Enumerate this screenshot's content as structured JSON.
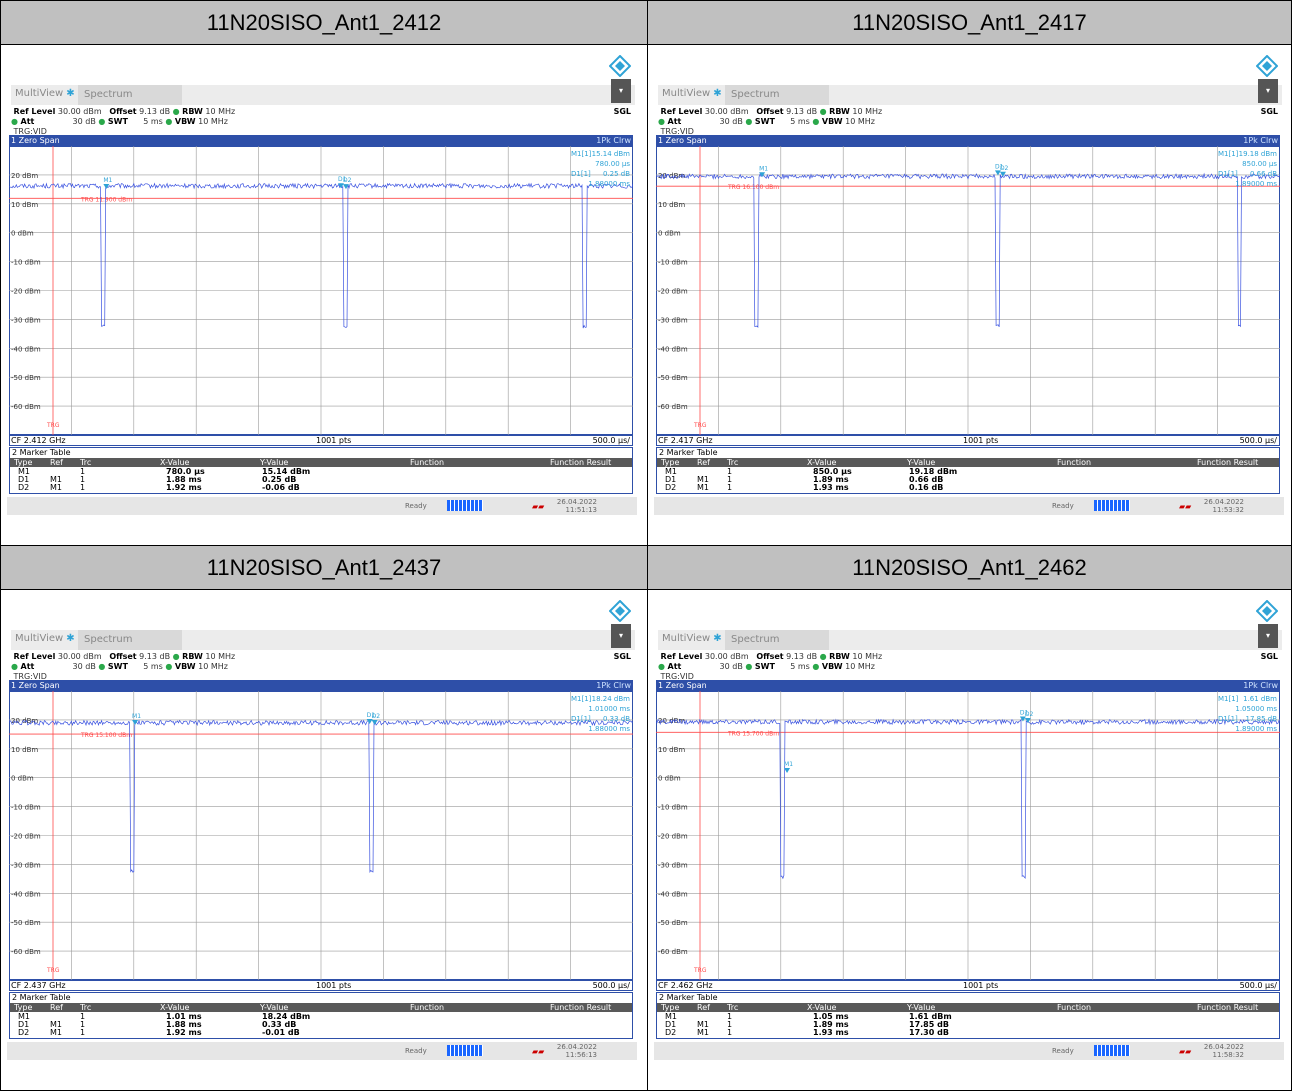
{
  "panels": [
    {
      "title": "11N20SISO_Ant1_2412",
      "ui": {
        "tab1": "MultiView",
        "tab2": "Spectrum",
        "mode": "SGL",
        "ref_level_label": "Ref Level",
        "ref_level": "30.00 dBm",
        "offset_label": "Offset",
        "offset": "9.13 dB",
        "rbw_label": "RBW",
        "rbw": "10 MHz",
        "att_label": "Att",
        "att": "30 dB",
        "swt_label": "SWT",
        "swt": "5 ms",
        "vbw_label": "VBW",
        "vbw": "10 MHz",
        "trg": "TRG:VID",
        "window": "1 Zero Span",
        "trace": "1Pk Clrw",
        "cf": "CF 2.412 GHz",
        "pts": "1001 pts",
        "div": "500.0 µs/",
        "trg_level": "TRG 11.900 dBm",
        "m1_label": "M1[1]",
        "m1_val": "15.14 dBm",
        "m1_time": "780.00 µs",
        "d1_label": "D1[1]",
        "d1_val": "0.25 dB",
        "d1_time": "1.88000 ms",
        "status": "Ready",
        "date": "26.04.2022",
        "time": "11:51:13"
      },
      "marker_table": {
        "title": "2 Marker Table",
        "headers": [
          "Type",
          "Ref",
          "Trc",
          "X-Value",
          "Y-Value",
          "Function",
          "Function Result"
        ],
        "rows": [
          [
            "M1",
            "",
            "1",
            "780.0 µs",
            "15.14 dBm"
          ],
          [
            "D1",
            "M1",
            "1",
            "1.88 ms",
            "0.25 dB"
          ],
          [
            "D2",
            "M1",
            "1",
            "1.92 ms",
            "-0.06 dB"
          ]
        ]
      }
    },
    {
      "title": "11N20SISO_Ant1_2417",
      "ui": {
        "tab1": "MultiView",
        "tab2": "Spectrum",
        "mode": "SGL",
        "ref_level_label": "Ref Level",
        "ref_level": "30.00 dBm",
        "offset_label": "Offset",
        "offset": "9.13 dB",
        "rbw_label": "RBW",
        "rbw": "10 MHz",
        "att_label": "Att",
        "att": "30 dB",
        "swt_label": "SWT",
        "swt": "5 ms",
        "vbw_label": "VBW",
        "vbw": "10 MHz",
        "trg": "TRG:VID",
        "window": "1 Zero Span",
        "trace": "1Pk Clrw",
        "cf": "CF 2.417 GHz",
        "pts": "1001 pts",
        "div": "500.0 µs/",
        "trg_level": "TRG 16.100 dBm",
        "m1_label": "M1[1]",
        "m1_val": "19.18 dBm",
        "m1_time": "850.00 µs",
        "d1_label": "D1[1]",
        "d1_val": "0.66 dB",
        "d1_time": "1.89000 ms",
        "status": "Ready",
        "date": "26.04.2022",
        "time": "11:53:32"
      },
      "marker_table": {
        "title": "2 Marker Table",
        "headers": [
          "Type",
          "Ref",
          "Trc",
          "X-Value",
          "Y-Value",
          "Function",
          "Function Result"
        ],
        "rows": [
          [
            "M1",
            "",
            "1",
            "850.0 µs",
            "19.18 dBm"
          ],
          [
            "D1",
            "M1",
            "1",
            "1.89 ms",
            "0.66 dB"
          ],
          [
            "D2",
            "M1",
            "1",
            "1.93 ms",
            "0.16 dB"
          ]
        ]
      }
    },
    {
      "title": "11N20SISO_Ant1_2437",
      "ui": {
        "tab1": "MultiView",
        "tab2": "Spectrum",
        "mode": "SGL",
        "ref_level_label": "Ref Level",
        "ref_level": "30.00 dBm",
        "offset_label": "Offset",
        "offset": "9.13 dB",
        "rbw_label": "RBW",
        "rbw": "10 MHz",
        "att_label": "Att",
        "att": "30 dB",
        "swt_label": "SWT",
        "swt": "5 ms",
        "vbw_label": "VBW",
        "vbw": "10 MHz",
        "trg": "TRG:VID",
        "window": "1 Zero Span",
        "trace": "1Pk Clrw",
        "cf": "CF 2.437 GHz",
        "pts": "1001 pts",
        "div": "500.0 µs/",
        "trg_level": "TRG 15.100 dBm",
        "m1_label": "M1[1]",
        "m1_val": "18.24 dBm",
        "m1_time": "1.01000 ms",
        "d1_label": "D1[1]",
        "d1_val": "0.33 dB",
        "d1_time": "1.88000 ms",
        "status": "Ready",
        "date": "26.04.2022",
        "time": "11:56:13"
      },
      "marker_table": {
        "title": "2 Marker Table",
        "headers": [
          "Type",
          "Ref",
          "Trc",
          "X-Value",
          "Y-Value",
          "Function",
          "Function Result"
        ],
        "rows": [
          [
            "M1",
            "",
            "1",
            "1.01 ms",
            "18.24 dBm"
          ],
          [
            "D1",
            "M1",
            "1",
            "1.88 ms",
            "0.33 dB"
          ],
          [
            "D2",
            "M1",
            "1",
            "1.92 ms",
            "-0.01 dB"
          ]
        ]
      }
    },
    {
      "title": "11N20SISO_Ant1_2462",
      "ui": {
        "tab1": "MultiView",
        "tab2": "Spectrum",
        "mode": "SGL",
        "ref_level_label": "Ref Level",
        "ref_level": "30.00 dBm",
        "offset_label": "Offset",
        "offset": "9.13 dB",
        "rbw_label": "RBW",
        "rbw": "10 MHz",
        "att_label": "Att",
        "att": "30 dB",
        "swt_label": "SWT",
        "swt": "5 ms",
        "vbw_label": "VBW",
        "vbw": "10 MHz",
        "trg": "TRG:VID",
        "window": "1 Zero Span",
        "trace": "1Pk Clrw",
        "cf": "CF 2.462 GHz",
        "pts": "1001 pts",
        "div": "500.0 µs/",
        "trg_level": "TRG 15.700 dBm",
        "m1_label": "M1[1]",
        "m1_val": "1.61 dBm",
        "m1_time": "1.05000 ms",
        "d1_label": "D1[1]",
        "d1_val": "17.85 dB",
        "d1_time": "1.89000 ms",
        "status": "Ready",
        "date": "26.04.2022",
        "time": "11:58:32"
      },
      "marker_table": {
        "title": "2 Marker Table",
        "headers": [
          "Type",
          "Ref",
          "Trc",
          "X-Value",
          "Y-Value",
          "Function",
          "Function Result"
        ],
        "rows": [
          [
            "M1",
            "",
            "1",
            "1.05 ms",
            "1.61 dBm"
          ],
          [
            "D1",
            "M1",
            "1",
            "1.89 ms",
            "17.85 dB"
          ],
          [
            "D2",
            "M1",
            "1",
            "1.93 ms",
            "17.30 dB"
          ]
        ]
      }
    }
  ],
  "chart_data": [
    {
      "type": "line",
      "title": "11N20SISO_Ant1_2412",
      "xlim": [
        0,
        5
      ],
      "x_unit": "ms",
      "ylim": [
        -70,
        30
      ],
      "y_unit": "dBm",
      "yticks": [
        "20 dBm",
        "10 dBm",
        "0 dBm",
        "-10 dBm",
        "-20 dBm",
        "-30 dBm",
        "-40 dBm",
        "-50 dBm",
        "-60 dBm"
      ],
      "trigger_level": 11.9,
      "on_level": 16.2,
      "off_level": -33,
      "dips": [
        [
          0.74,
          0.77
        ],
        [
          2.68,
          2.71
        ],
        [
          4.6,
          4.63
        ]
      ],
      "markers": [
        {
          "label": "M1",
          "x": 0.78,
          "y": 15.14
        },
        {
          "label": "D1",
          "x": 2.66,
          "y": 15.39
        },
        {
          "label": "D2",
          "x": 2.7,
          "y": 15.08
        }
      ]
    },
    {
      "type": "line",
      "title": "11N20SISO_Ant1_2417",
      "xlim": [
        0,
        5
      ],
      "x_unit": "ms",
      "ylim": [
        -70,
        30
      ],
      "y_unit": "dBm",
      "yticks": [
        "20 dBm",
        "10 dBm",
        "0 dBm",
        "-10 dBm",
        "-20 dBm",
        "-30 dBm",
        "-40 dBm",
        "-50 dBm",
        "-60 dBm"
      ],
      "trigger_level": 16.1,
      "on_level": 19.5,
      "off_level": -33,
      "dips": [
        [
          0.79,
          0.82
        ],
        [
          2.72,
          2.75
        ],
        [
          4.66,
          4.69
        ]
      ],
      "markers": [
        {
          "label": "M1",
          "x": 0.85,
          "y": 19.18
        },
        {
          "label": "D1",
          "x": 2.74,
          "y": 19.84
        },
        {
          "label": "D2",
          "x": 2.78,
          "y": 19.34
        }
      ]
    },
    {
      "type": "line",
      "title": "11N20SISO_Ant1_2437",
      "xlim": [
        0,
        5
      ],
      "x_unit": "ms",
      "ylim": [
        -70,
        30
      ],
      "y_unit": "dBm",
      "yticks": [
        "20 dBm",
        "10 dBm",
        "0 dBm",
        "-10 dBm",
        "-20 dBm",
        "-30 dBm",
        "-40 dBm",
        "-50 dBm",
        "-60 dBm"
      ],
      "trigger_level": 15.1,
      "on_level": 19.0,
      "off_level": -33,
      "dips": [
        [
          0.97,
          1.0
        ],
        [
          2.89,
          2.92
        ]
      ],
      "markers": [
        {
          "label": "M1",
          "x": 1.01,
          "y": 18.24
        },
        {
          "label": "D1",
          "x": 2.89,
          "y": 18.57
        },
        {
          "label": "D2",
          "x": 2.93,
          "y": 18.23
        }
      ]
    },
    {
      "type": "line",
      "title": "11N20SISO_Ant1_2462",
      "xlim": [
        0,
        5
      ],
      "x_unit": "ms",
      "ylim": [
        -70,
        30
      ],
      "y_unit": "dBm",
      "yticks": [
        "20 dBm",
        "10 dBm",
        "0 dBm",
        "-10 dBm",
        "-20 dBm",
        "-30 dBm",
        "-40 dBm",
        "-50 dBm",
        "-60 dBm"
      ],
      "trigger_level": 15.7,
      "on_level": 19.3,
      "off_level": -35,
      "dips": [
        [
          1.0,
          1.03
        ],
        [
          2.93,
          2.96
        ]
      ],
      "markers": [
        {
          "label": "M1",
          "x": 1.05,
          "y": 1.61
        },
        {
          "label": "D1",
          "x": 2.94,
          "y": 19.46
        },
        {
          "label": "D2",
          "x": 2.98,
          "y": 18.91
        }
      ]
    }
  ]
}
